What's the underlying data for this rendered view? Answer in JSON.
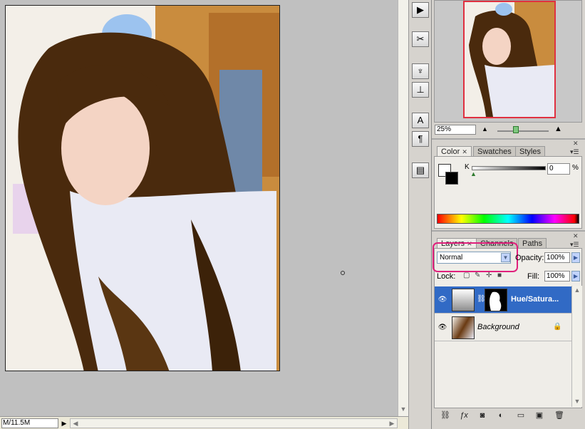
{
  "status": {
    "doc_size": "M/11.5M"
  },
  "navigator": {
    "zoom": "25%"
  },
  "color_panel": {
    "tabs": [
      "Color",
      "Swatches",
      "Styles"
    ],
    "k_label": "K",
    "k_value": "0",
    "k_unit": "%"
  },
  "layers_panel": {
    "tabs": [
      "Layers",
      "Channels",
      "Paths"
    ],
    "blend_mode": "Normal",
    "opacity_label": "Opacity:",
    "opacity_value": "100%",
    "lock_label": "Lock:",
    "fill_label": "Fill:",
    "fill_value": "100%",
    "layers": [
      {
        "name": "Hue/Satura...",
        "selected": true
      },
      {
        "name": "Background",
        "selected": false
      }
    ]
  },
  "dock": {
    "icons": [
      "play-icon",
      "tool-presets-icon",
      "brush-icon",
      "clone-source-icon",
      "character-icon",
      "paragraph-icon",
      "layer-comps-icon"
    ]
  },
  "colors": {
    "selection_blue": "#316ac5",
    "highlight_pink": "#e0207c"
  }
}
